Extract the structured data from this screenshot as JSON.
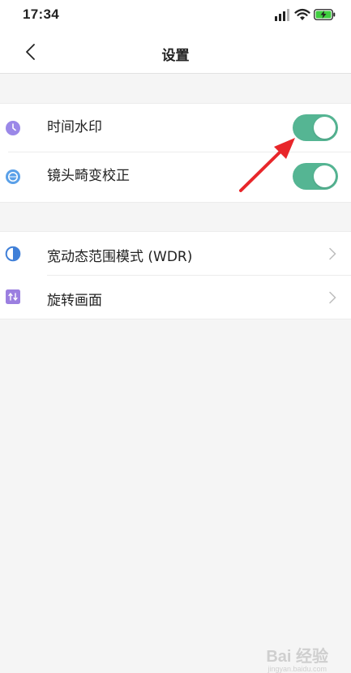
{
  "status_bar": {
    "time": "17:34",
    "icons": [
      "signal-icon",
      "wifi-icon",
      "battery-charging-icon"
    ]
  },
  "header": {
    "title": "设置",
    "back_icon": "chevron-left-icon"
  },
  "settings_group_1": {
    "items": [
      {
        "label": "时间水印",
        "icon": "clock-icon",
        "icon_color": "#9b88e8",
        "toggle_on": true
      },
      {
        "label": "镜头畸变校正",
        "icon": "lens-icon",
        "icon_color": "#5aa0e8",
        "toggle_on": true
      }
    ]
  },
  "settings_group_2": {
    "items": [
      {
        "label": "宽动态范围模式 (WDR)",
        "icon": "wdr-icon",
        "icon_color": "#3f7fd8"
      },
      {
        "label": "旋转画面",
        "icon": "rotate-icon",
        "icon_color": "#9b7fe0"
      }
    ]
  },
  "colors": {
    "toggle_on": "#55b593",
    "annotation_arrow": "#e8262a"
  },
  "watermark": {
    "text": "Bai 经验",
    "sub": "jingyan.baidu.com"
  }
}
